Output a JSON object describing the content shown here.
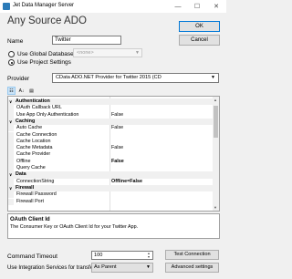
{
  "window": {
    "title": "Jet Data Manager Server",
    "minimize_glyph": "—",
    "maximize_glyph": "☐",
    "close_glyph": "✕"
  },
  "heading": "Any Source ADO",
  "buttons": {
    "ok": "OK",
    "cancel": "Cancel",
    "test_connection": "Test Connection",
    "advanced_settings": "Advanced settings"
  },
  "name": {
    "label": "Name",
    "value": "Twitter"
  },
  "database": {
    "use_global_label": "Use Global Database",
    "use_project_label": "Use Project Settings",
    "selected_option": "use-project-settings",
    "global_db_value": "<none>"
  },
  "provider": {
    "label": "Provider",
    "value": "CData ADO.NET Provider for Twitter 2015 (CD"
  },
  "property_grid": {
    "rows": [
      {
        "type": "category",
        "name": "Authentication",
        "toggle": "∨"
      },
      {
        "type": "prop",
        "name": "OAuth Callback URL",
        "value": ""
      },
      {
        "type": "prop",
        "name": "Use App Only Authentication",
        "value": "False"
      },
      {
        "type": "category",
        "name": "Caching",
        "toggle": "∨"
      },
      {
        "type": "prop",
        "name": "Auto Cache",
        "value": "False"
      },
      {
        "type": "prop",
        "name": "Cache Connection",
        "value": ""
      },
      {
        "type": "prop",
        "name": "Cache Location",
        "value": ""
      },
      {
        "type": "prop",
        "name": "Cache Metadata",
        "value": "False"
      },
      {
        "type": "prop",
        "name": "Cache Provider",
        "value": ""
      },
      {
        "type": "prop",
        "name": "Offline",
        "value": "False",
        "bold": true
      },
      {
        "type": "prop",
        "name": "Query Cache",
        "value": ""
      },
      {
        "type": "category",
        "name": "Data",
        "toggle": "∨"
      },
      {
        "type": "prop",
        "name": "ConnectionString",
        "value": "Offline=False",
        "bold": true
      },
      {
        "type": "category",
        "name": "Firewall",
        "toggle": "∨"
      },
      {
        "type": "prop",
        "name": "Firewall Password",
        "value": ""
      },
      {
        "type": "prop",
        "name": "Firewall Port",
        "value": ""
      }
    ]
  },
  "description": {
    "title": "OAuth Client Id",
    "text": "The Consumer Key or OAuth Client Id for your Twitter App."
  },
  "command_timeout": {
    "label": "Command Timeout",
    "value": "100"
  },
  "integration": {
    "label": "Use Integration Services for transfer",
    "value": "As Parent"
  }
}
